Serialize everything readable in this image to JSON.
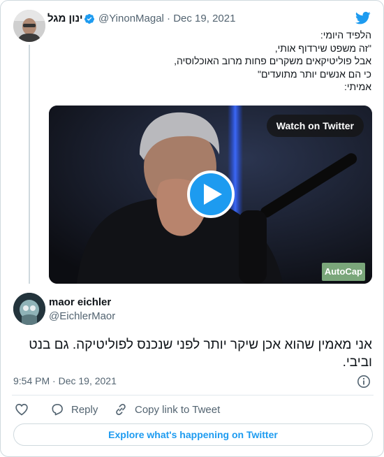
{
  "quoted_tweet": {
    "author_name": "ינון מגל",
    "handle_date": "@YinonMagal · Dec 19, 2021",
    "lines": [
      "הלפיד היומי:",
      "\"זה משפט שירדוף אותי,",
      "אבל פוליטיקאים משקרים פחות מרוב האוכלוסיה,",
      "כי הם אנשים יותר מתועדים\"",
      "אמיתי:"
    ],
    "video": {
      "watch_label": "Watch on Twitter",
      "autocap_label": "AutoCap"
    }
  },
  "tweet": {
    "author_name": "maor eichler",
    "handle": "@EichlerMaor",
    "lines": [
      "אני מאמין שהוא אכן שיקר יותר לפני שנכנס לפוליטיקה. גם בנט",
      "וביבי."
    ],
    "timestamp": "9:54 PM · Dec 19, 2021"
  },
  "actions": {
    "reply_label": "Reply",
    "copy_link_label": "Copy link to Tweet"
  },
  "explore_label": "Explore what's happening on Twitter",
  "icons": [
    "twitter-bird-icon",
    "verified-badge-icon",
    "play-icon",
    "info-icon",
    "heart-icon",
    "reply-icon",
    "link-icon"
  ],
  "colors": {
    "accent": "#1d9bf0",
    "secondary_text": "#536471",
    "border": "#cfd9de"
  }
}
